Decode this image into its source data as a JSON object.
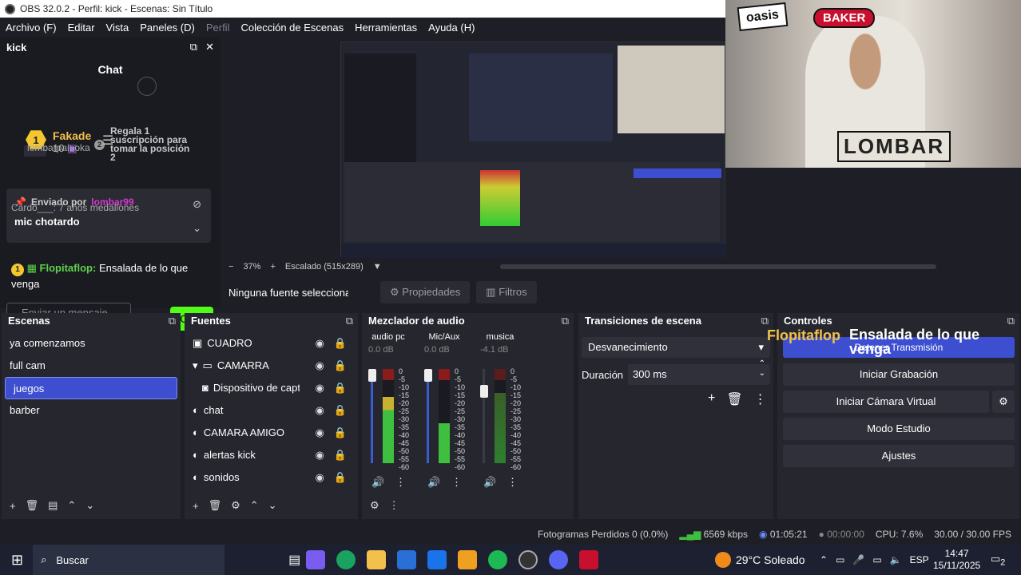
{
  "window": {
    "title": "OBS 32.0.2 - Perfil: kick - Escenas: Sin Título"
  },
  "menu": [
    "Archivo (F)",
    "Editar",
    "Vista",
    "Paneles (D)",
    "Perfil",
    "Colección de Escenas",
    "Herramientas",
    "Ayuda (H)"
  ],
  "kick_dock": {
    "title": "kick",
    "chat_title": "Chat",
    "gift_user": "Fakade",
    "gift_count": "10",
    "gift_rank": "1",
    "gift_line1": "Regala 1",
    "gift_line2": "suscripción para",
    "gift_line3": "tomar la posición",
    "gift_line4": "2",
    "gift2_rank": "2",
    "behind_msg": "lombarpai: oka",
    "pinned_label": "Enviado por",
    "pinned_user": "lombar99",
    "pinned_msg": "mic chotardo",
    "behind2_msg": "Cardo___: 7 años medallones",
    "msg_rank": "1",
    "msg_user": "Flopitaflop:",
    "msg_text": "Ensalada de lo que venga",
    "input_placeholder": "Enviar un mensaje",
    "send_label": "Chat"
  },
  "zoom": {
    "minus": "−",
    "percent": "37%",
    "plus": "+",
    "scale": "Escalado (515x289)"
  },
  "source_bar": {
    "no_source": "Ninguna fuente seleccionad",
    "properties": "Propiedades",
    "filters": "Filtros"
  },
  "scenes": {
    "title": "Escenas",
    "items": [
      "ya comenzamos",
      "full cam",
      "juegos",
      "barber"
    ]
  },
  "sources": {
    "title": "Fuentes",
    "items": [
      "CUADRO",
      "CAMARRA",
      "Dispositivo de captu",
      "chat",
      "CAMARA AMIGO",
      "alertas kick",
      "sonidos"
    ]
  },
  "mixer": {
    "title": "Mezclador de audio",
    "channels": [
      {
        "name": "audio pc",
        "db": "0.0 dB"
      },
      {
        "name": "Mic/Aux",
        "db": "0.0 dB"
      },
      {
        "name": "musica",
        "db": "-4.1 dB"
      }
    ],
    "ticks": [
      "0",
      "-5",
      "-10",
      "-15",
      "-20",
      "-25",
      "-30",
      "-35",
      "-40",
      "-45",
      "-50",
      "-55",
      "-60"
    ]
  },
  "transitions": {
    "title": "Transiciones de escena",
    "type": "Desvanecimiento",
    "duration_label": "Duración",
    "duration_value": "300 ms"
  },
  "controls": {
    "title": "Controles",
    "buttons": [
      "Detener Transmisión",
      "Iniciar Grabación",
      "Iniciar Cámara Virtual",
      "Modo Estudio",
      "Ajustes"
    ]
  },
  "overlay_alert": {
    "user": "Flopitaflop",
    "msg": "Ensalada de lo que venga"
  },
  "status": {
    "dropped": "Fotogramas Perdidos 0 (0.0%)",
    "kbps": "6569 kbps",
    "stream_time": "01:05:21",
    "rec_time": "00:00:00",
    "cpu": "CPU: 7.6%",
    "fps": "30.00 / 30.00 FPS"
  },
  "taskbar": {
    "search": "Buscar",
    "weather": "29°C Soleado",
    "lang": "ESP",
    "time": "14:47",
    "date": "15/11/2025",
    "notif": "2"
  },
  "cam_stickers": {
    "oasis": "oasis",
    "baker": "BAKER",
    "lombar": "LOMBAR"
  }
}
